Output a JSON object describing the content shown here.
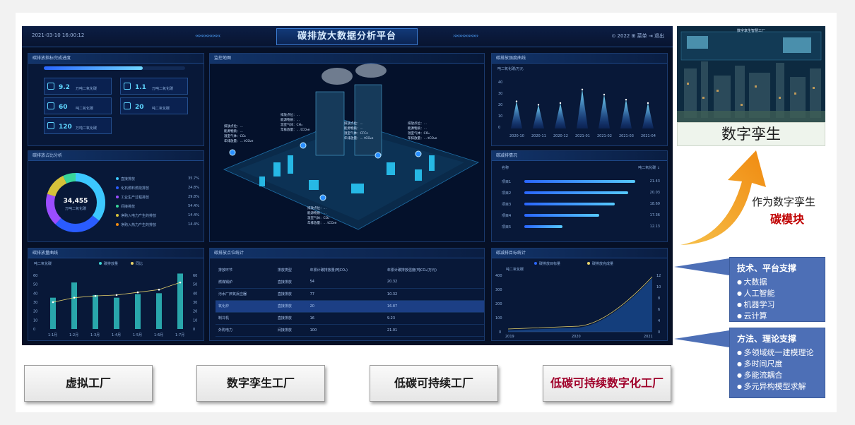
{
  "dashboard": {
    "time": "2021-03-10 16:00:12",
    "title": "碳排放大数据分析平台",
    "header_right": "⊙ 2022   ⊞ 菜单   ⇥ 退出",
    "panel_target": {
      "title": "碳排放指标完成进度",
      "progress_pct": 0.7,
      "items": [
        {
          "value": "9.2",
          "unit": "万吨二氧化碳"
        },
        {
          "value": "1.1",
          "unit": "万吨二氧化碳"
        },
        {
          "value": "60",
          "unit": "吨二氧化碳"
        },
        {
          "value": "20",
          "unit": "吨二氧化碳"
        },
        {
          "value": "120",
          "unit": "万吨二氧化碳"
        }
      ]
    },
    "panel_share": {
      "title": "碳排放占比分析",
      "center_value": "34,455",
      "center_unit": "万吨二氧化碳",
      "legend": [
        {
          "label": "直接排放",
          "value": "35.7%"
        },
        {
          "label": "化石燃料燃烧排放",
          "value": "24.8%"
        },
        {
          "label": "工业生产过程排放",
          "value": "29.8%"
        },
        {
          "label": "间接排放",
          "value": "54.4%"
        },
        {
          "label": "净购入电力产生的排放",
          "value": "14.4%"
        },
        {
          "label": "净购入热力产生的排放",
          "value": "14.4%"
        }
      ]
    },
    "panel_map": {
      "title": "监控地图"
    },
    "panel_trend": {
      "title": "碳排放强度曲线",
      "unit": "吨二氧化碳/万元",
      "x": [
        "2020-10",
        "2020-11",
        "2020-12",
        "2021-01",
        "2021-02",
        "2021-03",
        "2021-04"
      ]
    },
    "panel_rank": {
      "title": "碳减排情况",
      "col1": "名称",
      "col2": "吨二氧化碳 ↓",
      "items": [
        {
          "name": "项目1",
          "value": "21.43",
          "frac": 0.98
        },
        {
          "name": "项目2",
          "value": "20.03",
          "frac": 0.92
        },
        {
          "name": "项目3",
          "value": "18.69",
          "frac": 0.8
        },
        {
          "name": "项目4",
          "value": "17.36",
          "frac": 0.66
        },
        {
          "name": "项目5",
          "value": "12.13",
          "frac": 0.34
        }
      ]
    },
    "panel_monthly": {
      "title": "碳排放量曲线",
      "ylabel": "吨二氧化碳",
      "legend1": "碳排放量",
      "legend2": "同比",
      "x": [
        "1-1月",
        "1-2月",
        "1-3月",
        "1-4月",
        "1-5月",
        "1-6月",
        "1-7月"
      ],
      "bars": [
        35,
        52,
        38,
        35,
        39,
        40,
        62
      ],
      "line": [
        30,
        35,
        37,
        38,
        41,
        44,
        52
      ],
      "ylim": [
        0,
        60
      ]
    },
    "panel_table": {
      "title": "碳排放点位统计",
      "headers": [
        "排放环节",
        "排放类型",
        "年累计碳排放量(吨CO₂)",
        "年累计碳排放强度(吨CO₂/万元)"
      ],
      "rows": [
        [
          "燃煤锅炉",
          "直接排放",
          "54",
          "20.32"
        ],
        [
          "污水厂厌氧反应器",
          "直接排放",
          "77",
          "10.32"
        ],
        [
          "氧化炉",
          "直接排放",
          "20",
          "16.87"
        ],
        [
          "制冷机",
          "直接排放",
          "16",
          "9.23"
        ],
        [
          "外购电力",
          "间接排放",
          "100",
          "21.01"
        ]
      ]
    },
    "panel_reduce": {
      "title": "碳减排目标统计",
      "legend1": "碳排放目标量",
      "legend2": "碳排放完成量",
      "ylabel": "吨二氧化碳",
      "x": [
        "2019",
        "2020",
        "2021"
      ]
    }
  },
  "twin": {
    "caption": "数字孪生",
    "img_caption": "数字孪生智慧工厂"
  },
  "arrow": {
    "line1": "作为数字孪生",
    "line2": "碳模块"
  },
  "tech_box": {
    "title": "技术、平台支撑",
    "items": [
      "大数据",
      "人工智能",
      "机器学习",
      "云计算"
    ]
  },
  "method_box": {
    "title": "方法、理论支撑",
    "items": [
      "多领域统一建模理论",
      "多时间尺度",
      "多能流耦合",
      "多元异构模型求解"
    ]
  },
  "buttons": [
    "虚拟工厂",
    "数字孪生工厂",
    "低碳可持续工厂",
    "低碳可持续数字化工厂"
  ],
  "colors": {
    "accent_red": "#c00000",
    "box_blue": "#4d6fb6",
    "dash_bg": "#061026",
    "arrow_orange": "#f39a1e"
  }
}
